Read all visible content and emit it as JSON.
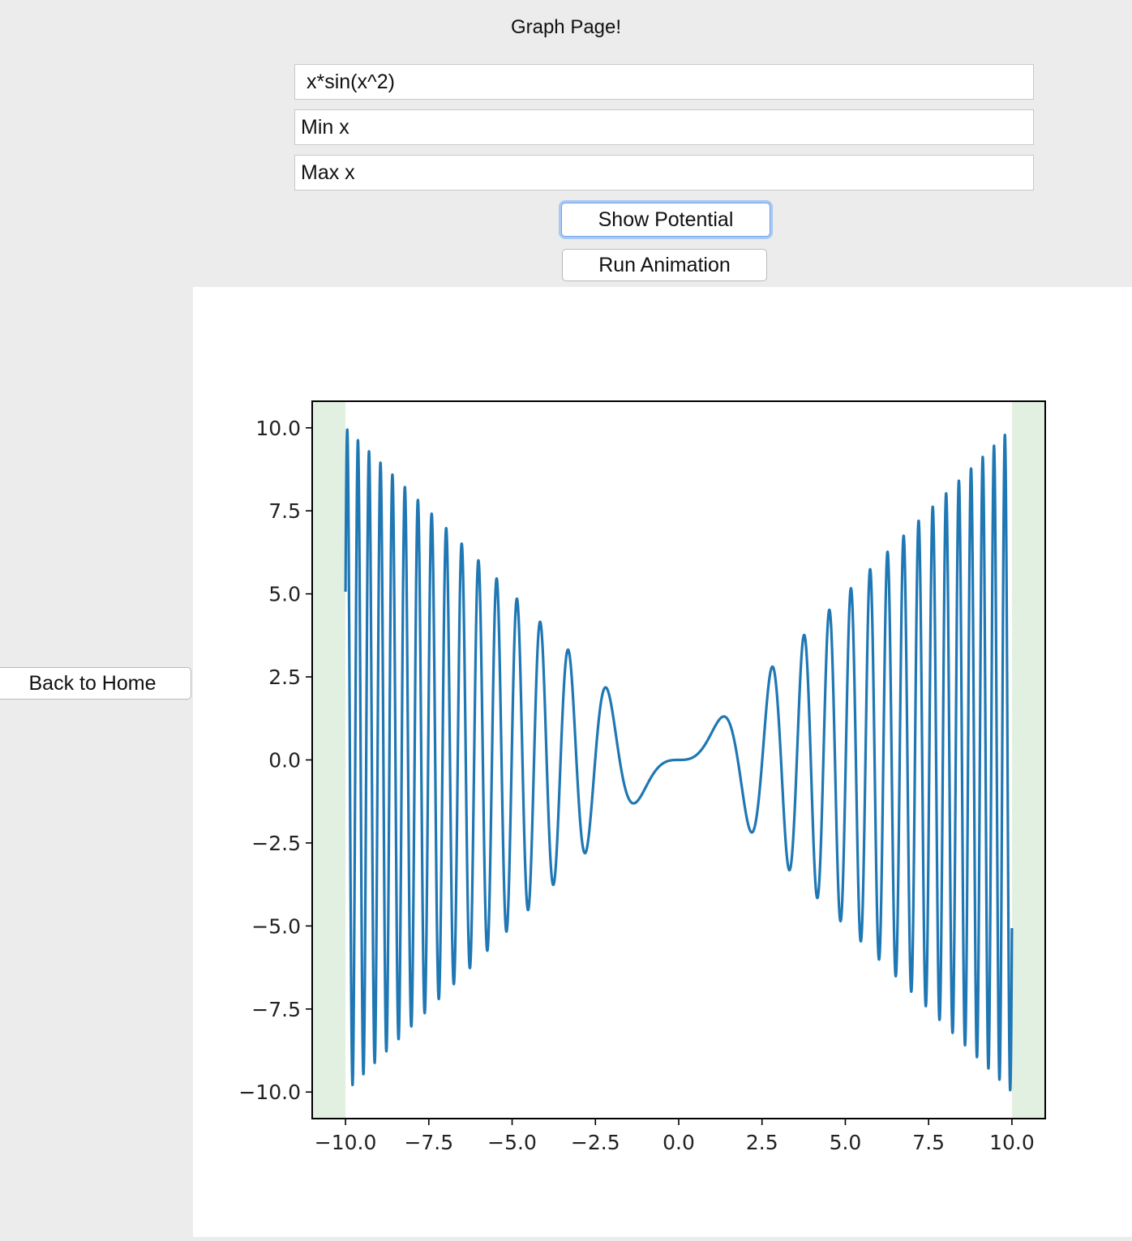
{
  "window": {
    "title": "Graph Page!"
  },
  "inputs": {
    "function_value": "x*sin(x^2)",
    "min_x_placeholder": "Min x",
    "max_x_placeholder": "Max x"
  },
  "buttons": {
    "show_potential": "Show Potential",
    "run_animation": "Run Animation",
    "back_home": "Back to Home"
  },
  "colors": {
    "line": "#1f77b4",
    "span_fill": "#e2f0e2",
    "background": "#ececec"
  },
  "chart_data": {
    "type": "line",
    "title": "",
    "xlabel": "",
    "ylabel": "",
    "function": "x*sin(x^2)",
    "x_range": [
      -10,
      10
    ],
    "xlim": [
      -11,
      11
    ],
    "ylim": [
      -10.8,
      10.8
    ],
    "xticks": [
      -10,
      -7.5,
      -5,
      -2.5,
      0,
      2.5,
      5,
      7.5,
      10
    ],
    "yticks": [
      -10,
      -7.5,
      -5,
      -2.5,
      0,
      2.5,
      5,
      7.5,
      10
    ],
    "xtick_labels": [
      "−10.0",
      "−7.5",
      "−5.0",
      "−2.5",
      "0.0",
      "2.5",
      "5.0",
      "7.5",
      "10.0"
    ],
    "ytick_labels": [
      "−10.0",
      "−7.5",
      "−5.0",
      "−2.5",
      "0.0",
      "2.5",
      "5.0",
      "7.5",
      "10.0"
    ],
    "shaded_regions": [
      [
        -11,
        -10
      ],
      [
        10,
        11
      ]
    ],
    "grid": false
  }
}
